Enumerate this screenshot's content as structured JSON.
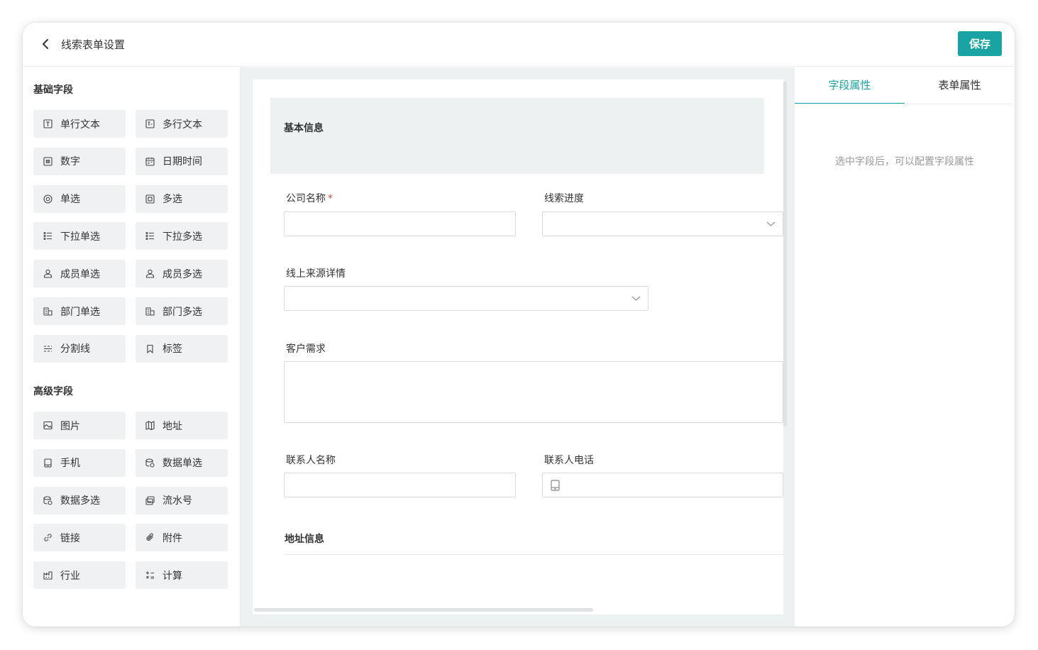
{
  "header": {
    "title": "线索表单设置",
    "save_label": "保存"
  },
  "sidebar": {
    "basic_heading": "基础字段",
    "basic_fields": [
      {
        "label": "单行文本",
        "icon": "single-line-text-icon"
      },
      {
        "label": "多行文本",
        "icon": "multi-line-text-icon"
      },
      {
        "label": "数字",
        "icon": "number-icon"
      },
      {
        "label": "日期时间",
        "icon": "calendar-icon"
      },
      {
        "label": "单选",
        "icon": "radio-icon"
      },
      {
        "label": "多选",
        "icon": "checkbox-icon"
      },
      {
        "label": "下拉单选",
        "icon": "dropdown-list-icon"
      },
      {
        "label": "下拉多选",
        "icon": "dropdown-list-icon"
      },
      {
        "label": "成员单选",
        "icon": "member-icon"
      },
      {
        "label": "成员多选",
        "icon": "member-icon"
      },
      {
        "label": "部门单选",
        "icon": "department-icon"
      },
      {
        "label": "部门多选",
        "icon": "department-icon"
      },
      {
        "label": "分割线",
        "icon": "divider-line-icon"
      },
      {
        "label": "标签",
        "icon": "bookmark-icon"
      }
    ],
    "advanced_heading": "高级字段",
    "advanced_fields": [
      {
        "label": "图片",
        "icon": "image-icon"
      },
      {
        "label": "地址",
        "icon": "map-icon"
      },
      {
        "label": "手机",
        "icon": "phone-icon"
      },
      {
        "label": "数据单选",
        "icon": "database-icon"
      },
      {
        "label": "数据多选",
        "icon": "database-icon"
      },
      {
        "label": "流水号",
        "icon": "serial-number-icon"
      },
      {
        "label": "链接",
        "icon": "link-icon"
      },
      {
        "label": "附件",
        "icon": "paperclip-icon"
      },
      {
        "label": "行业",
        "icon": "industry-icon"
      },
      {
        "label": "计算",
        "icon": "calculator-icon"
      }
    ]
  },
  "canvas": {
    "group_basic_title": "基本信息",
    "fields": {
      "company_name": {
        "label": "公司名称",
        "required_mark": "*"
      },
      "lead_progress": {
        "label": "线索进度"
      },
      "online_source": {
        "label": "线上来源详情"
      },
      "customer_needs": {
        "label": "客户需求"
      },
      "contact_name": {
        "label": "联系人名称"
      },
      "contact_phone": {
        "label": "联系人电话"
      }
    },
    "group_address_title": "地址信息"
  },
  "right_panel": {
    "tabs": [
      "字段属性",
      "表单属性"
    ],
    "active_tab": 0,
    "hint": "选中字段后，可以配置字段属性"
  },
  "colors": {
    "accent": "#1aa3a3",
    "required": "#e84b4b",
    "field_bg": "#eff1f2"
  }
}
